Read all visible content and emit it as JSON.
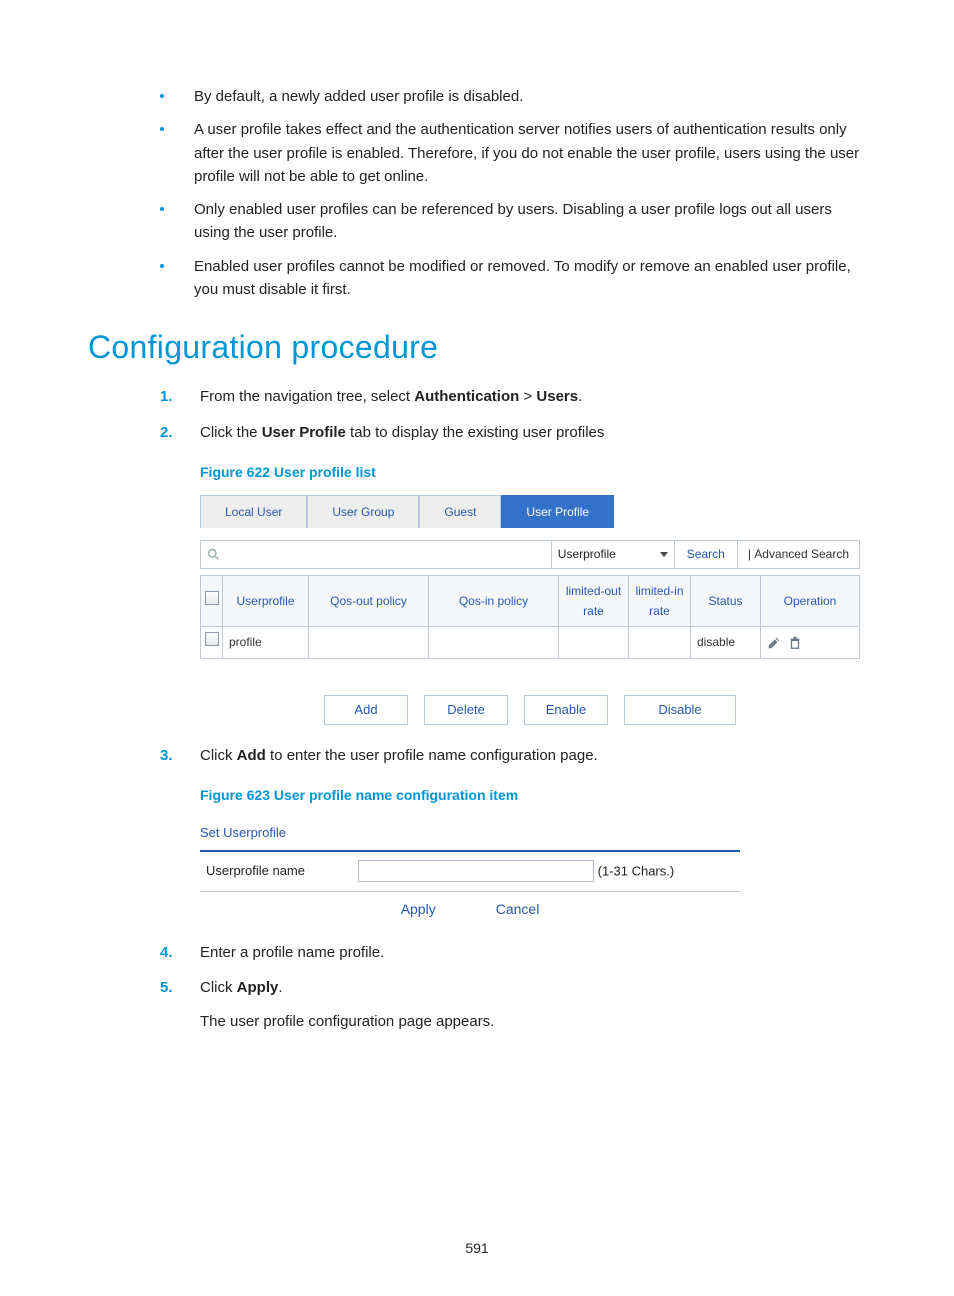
{
  "bullets": [
    "By default, a newly added user profile is disabled.",
    "A user profile takes effect and the authentication server notifies users of authentication results only after the user profile is enabled. Therefore, if you do not enable the user profile, users using the user profile will not be able to get online.",
    "Only enabled user profiles can be referenced by users. Disabling a user profile logs out all users using the user profile.",
    "Enabled user profiles cannot be modified or removed. To modify or remove an enabled user profile, you must disable it first."
  ],
  "section_heading": "Configuration procedure",
  "step1": {
    "prefix": "From the navigation tree, select ",
    "b1": "Authentication",
    "sep": " > ",
    "b2": "Users",
    "suffix": "."
  },
  "step2": {
    "prefix": "Click the ",
    "b1": "User Profile",
    "suffix": " tab to display the existing user profiles"
  },
  "fig622_caption": "Figure 622 User profile list",
  "fig622": {
    "tabs": [
      "Local User",
      "User Group",
      "Guest",
      "User Profile"
    ],
    "active_tab": 3,
    "search_select": "Userprofile",
    "search_btn": "Search",
    "adv_search": "Advanced Search",
    "columns": [
      "Userprofile",
      "Qos-out policy",
      "Qos-in policy",
      "limited-out rate",
      "limited-in rate",
      "Status",
      "Operation"
    ],
    "row": {
      "userprofile": "profile",
      "qos_out": "",
      "qos_in": "",
      "lim_out": "",
      "lim_in": "",
      "status": "disable"
    },
    "actions": [
      "Add",
      "Delete",
      "Enable",
      "Disable"
    ]
  },
  "step3": {
    "prefix": "Click ",
    "b1": "Add",
    "suffix": " to enter the user profile name configuration page."
  },
  "fig623_caption": "Figure 623 User profile name configuration item",
  "fig623": {
    "title": "Set Userprofile",
    "label": "Userprofile name",
    "hint": "(1-31 Chars.)",
    "apply": "Apply",
    "cancel": "Cancel"
  },
  "step4": "Enter a profile name profile.",
  "step5": {
    "prefix": "Click ",
    "b1": "Apply",
    "suffix": "."
  },
  "step5_sub": "The user profile configuration page appears.",
  "page_no": "591"
}
